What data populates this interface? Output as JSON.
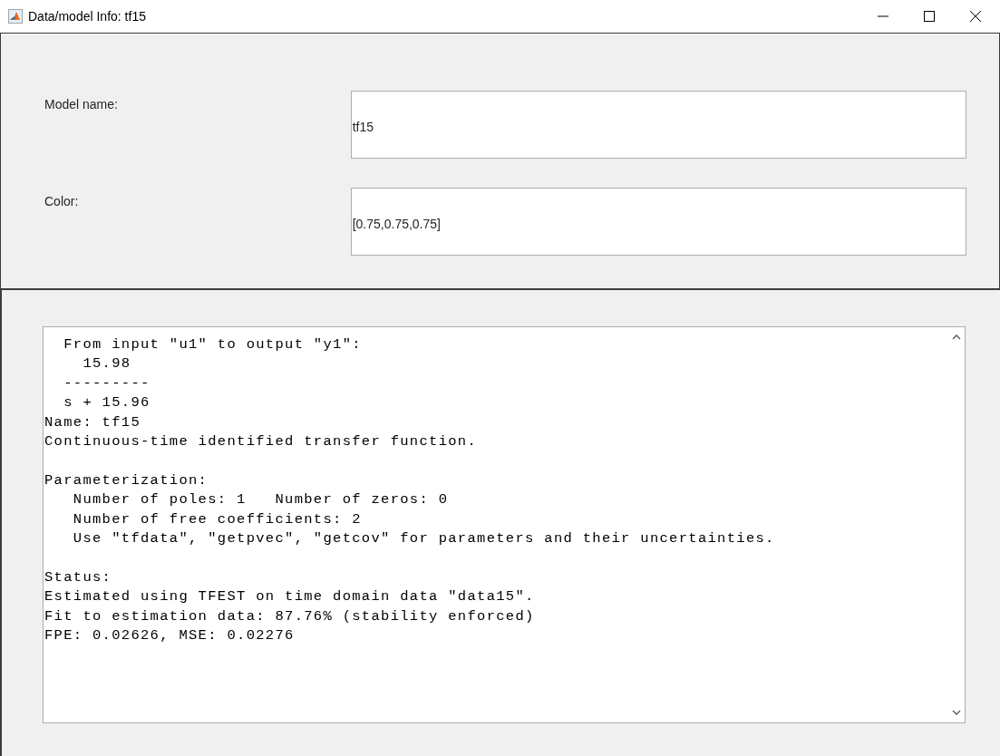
{
  "window": {
    "title": "Data/model Info: tf15"
  },
  "fields": [
    {
      "label": "Model name:",
      "value": "tf15"
    },
    {
      "label": "Color:",
      "value": "[0.75,0.75,0.75]"
    }
  ],
  "info_text": {
    "paragraphs": [
      [
        "  From input \"u1\" to output \"y1\":",
        "    15.98",
        "  ---------",
        "  s + 15.96",
        "Name: tf15",
        "Continuous-time identified transfer function."
      ],
      [
        "Parameterization:",
        "   Number of poles: 1   Number of zeros: 0",
        "   Number of free coefficients: 2",
        "   Use \"tfdata\", \"getpvec\", \"getcov\" for parameters and their uncertainties."
      ],
      [
        "Status:",
        "Estimated using TFEST on time domain data \"data15\".",
        "Fit to estimation data: 87.76% (stability enforced)",
        "FPE: 0.02626, MSE: 0.02276"
      ]
    ]
  }
}
